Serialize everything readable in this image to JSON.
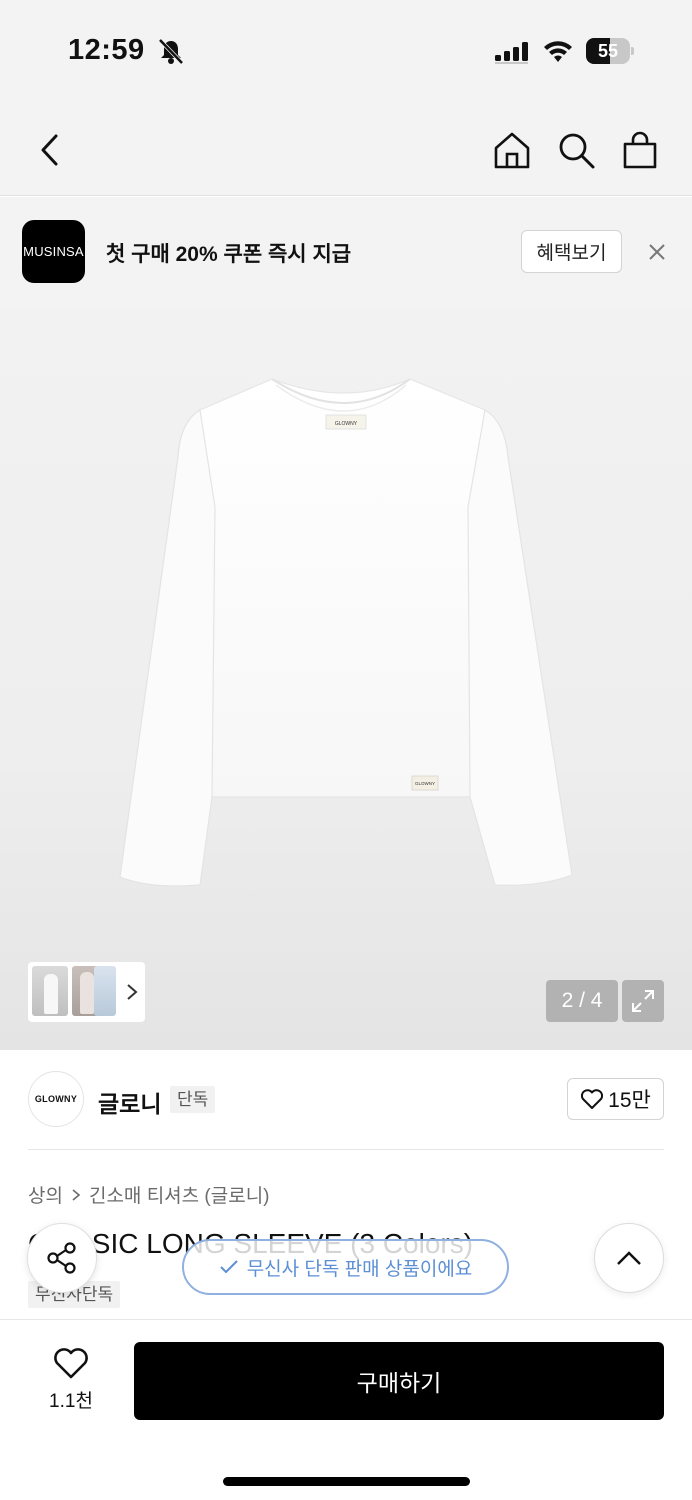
{
  "status_bar": {
    "time": "12:59",
    "battery": "55",
    "battery_level_percent": 55,
    "icons": [
      "bell-slash-icon",
      "cellular-signal-icon",
      "wifi-icon",
      "battery-icon"
    ]
  },
  "nav": {
    "icons": [
      "chevron-left-icon",
      "home-icon",
      "search-icon",
      "shopping-bag-icon"
    ]
  },
  "promo": {
    "logo": "MUSINSA",
    "text": "첫 구매 20% 쿠폰 즉시 지급",
    "button": "혜택보기",
    "close_icon": "close-icon"
  },
  "gallery": {
    "pager": "2 / 4",
    "current": 2,
    "total": 4,
    "expand_icon": "expand-icon",
    "thumbs_arrow_icon": "chevron-right-icon",
    "shirt_label": "GLOWNY",
    "hem_label": "GLOWNY"
  },
  "brand": {
    "logo": "GLOWNY",
    "name": "글로니",
    "badge": "단독",
    "likes": "15만"
  },
  "product": {
    "breadcrumb": [
      "상의",
      "긴소매 티셔츠 (글로니)"
    ],
    "title": "C    ASSIC LONG SLEEVE (3 Colors)",
    "tag": "무신사단독"
  },
  "toast": {
    "text": "무신사 단독 판매 상품이에요",
    "icon": "check-icon"
  },
  "bottom": {
    "wish_count": "1.1천",
    "buy_label": "구매하기"
  },
  "colors": {
    "accent_toast": "#5b8fd6",
    "buy_button": "#000000",
    "background_gray": "#f3f3f3"
  }
}
